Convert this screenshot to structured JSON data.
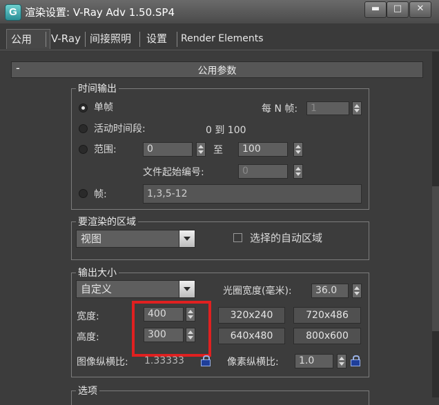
{
  "window": {
    "title": "渲染设置: V-Ray Adv 1.50.SP4",
    "app_icon_letter": "G",
    "minimize_glyph": "▬",
    "restore_glyph": "□",
    "close_glyph": "✕"
  },
  "tabs": [
    {
      "label": "公用",
      "active": true
    },
    {
      "label": "V-Ray"
    },
    {
      "label": "间接照明"
    },
    {
      "label": "设置"
    },
    {
      "label": "Render Elements"
    }
  ],
  "rollout": {
    "collapse": "-",
    "title": "公用参数"
  },
  "time_output": {
    "group_label": "时间输出",
    "single": "单帧",
    "every_n_label": "每 N 帧:",
    "every_n_value": "1",
    "active_segment": "活动时间段:",
    "active_range": "0 到 100",
    "range": "范围:",
    "range_from": "0",
    "range_to_label": "至",
    "range_to": "100",
    "file_start_label": "文件起始编号:",
    "file_start_value": "0",
    "frames": "帧:",
    "frames_value": "1,3,5-12",
    "selected_option": "单帧"
  },
  "render_region": {
    "group_label": "要渲染的区域",
    "dropdown_value": "视图",
    "auto_region_label": "选择的自动区域",
    "auto_region_checked": false
  },
  "output_size": {
    "group_label": "输出大小",
    "dropdown_value": "自定义",
    "aperture_label": "光圈宽度(毫米):",
    "aperture_value": "36.0",
    "width_label": "宽度:",
    "width_value": "400",
    "height_label": "高度:",
    "height_value": "300",
    "presets": [
      "320x240",
      "720x486",
      "640x480",
      "800x600"
    ],
    "image_aspect_label": "图像纵横比:",
    "image_aspect_value": "1.33333",
    "pixel_aspect_label": "像素纵横比:",
    "pixel_aspect_value": "1.0"
  },
  "options": {
    "group_label": "选项"
  },
  "colors": {
    "highlight": "#e02020",
    "lock": "#1f3f9a"
  }
}
